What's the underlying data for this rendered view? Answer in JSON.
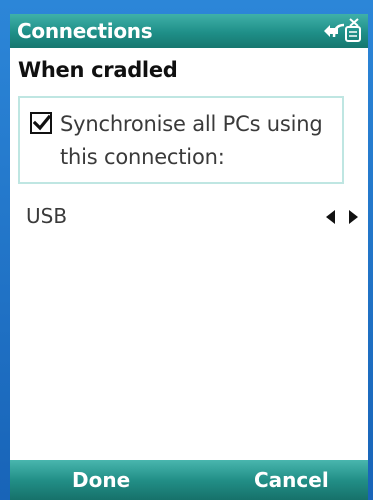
{
  "title_bar": {
    "title": "Connections",
    "icon": "sync-connection-icon"
  },
  "heading": "When cradled",
  "sync_option": {
    "checked": true,
    "label": "Synchronise all PCs using this connection:"
  },
  "connection_select": {
    "value": "USB"
  },
  "soft_keys": {
    "left": "Done",
    "right": "Cancel"
  },
  "colors": {
    "bezel": "#1a6fc4",
    "titlebar": "#1f8f88",
    "option_border": "#bfe6e2"
  }
}
